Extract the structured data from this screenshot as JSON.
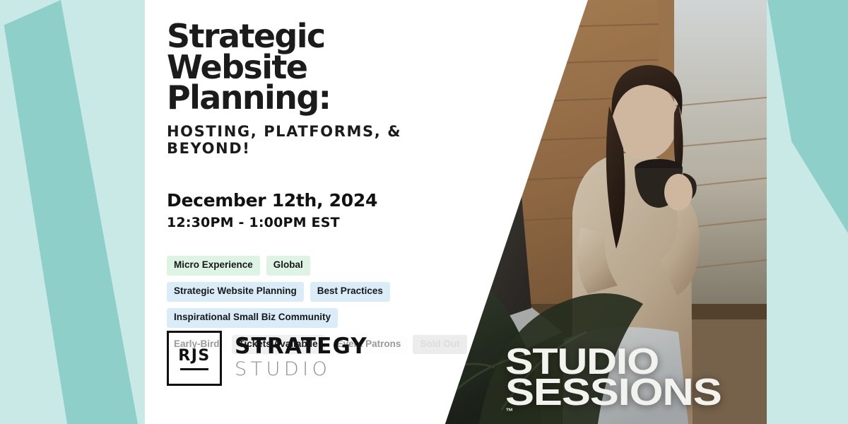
{
  "event": {
    "title_lines": [
      "Strategic",
      "Website Planning:"
    ],
    "subtitle": "HOSTING, PLATFORMS, & BEYOND!",
    "date": "December 12th, 2024",
    "time": "12:30PM - 1:00PM EST"
  },
  "tags": {
    "row1": [
      {
        "label": "Micro Experience",
        "style": "mint"
      },
      {
        "label": "Global",
        "style": "mint"
      }
    ],
    "row2": [
      {
        "label": "Strategic Website Planning",
        "style": "blue"
      },
      {
        "label": "Best Practices",
        "style": "blue"
      }
    ],
    "row3": [
      {
        "label": "Inspirational Small Biz Community",
        "style": "blue"
      }
    ],
    "status": [
      {
        "label": "Early-Bird",
        "style": "muted"
      },
      {
        "label": "Tickets Availabile",
        "style": "dark"
      },
      {
        "label": "Event Patrons",
        "style": "muted"
      },
      {
        "label": "Sold Out",
        "style": "off"
      }
    ]
  },
  "logo": {
    "monogram": "RJS",
    "word_primary": "STRATEGY",
    "word_secondary": "STUDIO"
  },
  "sessions_mark": {
    "line1": "STUDIO",
    "line2": "SESSIONS",
    "trademark": "™"
  },
  "colors": {
    "teal_dark": "#8fcfc9",
    "teal_light": "#c9e9e7",
    "tag_mint": "#ddf3e4",
    "tag_blue": "#d9ecf7",
    "ink": "#1b1b1b",
    "muted": "#9a9a9a"
  },
  "photo": {
    "description": "Woman in cream knit sweater holding a dark mug with a laptop on her lap beside a cabin window"
  }
}
